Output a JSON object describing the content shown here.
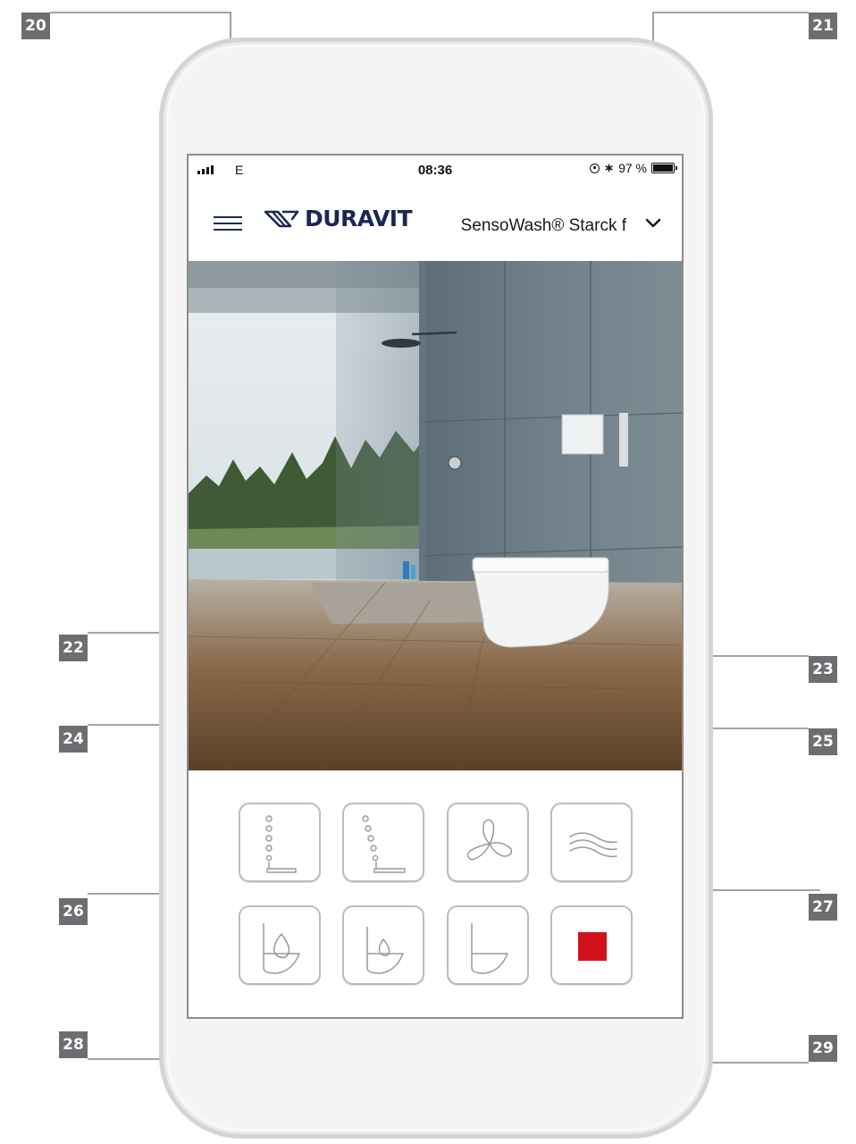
{
  "callouts": {
    "c20": "20",
    "c21": "21",
    "c22": "22",
    "c23": "23",
    "c24": "24",
    "c25": "25",
    "c26": "26",
    "c27": "27",
    "c28": "28",
    "c29": "29"
  },
  "status_bar": {
    "carrier": "E",
    "time": "08:36",
    "bluetooth": "∗",
    "battery": "97 %"
  },
  "header": {
    "brand": "DURAVIT",
    "device_name": "SensoWash® Starck f"
  },
  "buttons": [
    {
      "id": "rear-wash",
      "icon": "rear-wash-icon"
    },
    {
      "id": "lady-wash",
      "icon": "lady-wash-icon"
    },
    {
      "id": "dryer",
      "icon": "fan-icon"
    },
    {
      "id": "odor-extraction",
      "icon": "air-waves-icon"
    },
    {
      "id": "seat-flush-1",
      "icon": "seat-drop-icon"
    },
    {
      "id": "seat-flush-2",
      "icon": "seat-drop-small-icon"
    },
    {
      "id": "seat",
      "icon": "seat-icon"
    },
    {
      "id": "stop",
      "icon": "stop-square-icon"
    }
  ],
  "colors": {
    "callout_bg": "#6d6e71",
    "brand_navy": "#1a2756",
    "stop_red": "#d1121c",
    "button_border": "#bcbcbc"
  }
}
